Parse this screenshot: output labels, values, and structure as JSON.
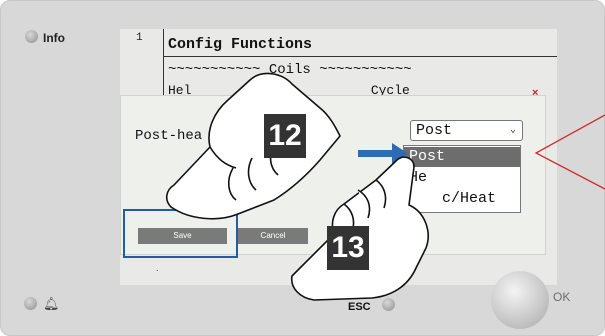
{
  "device": {
    "info_label": "Info",
    "esc_label": "ESC",
    "ok_label": "OK",
    "bell_icon": "bell-icon"
  },
  "screen": {
    "line_number": "1",
    "title": "Config Functions",
    "section": "~~~~~~~~~~~ Coils ~~~~~~~~~~~",
    "partial_row": "Hel                       Cycle",
    "dialog": {
      "label": "Post-hea",
      "close": "×",
      "select_value": "Post",
      "options": [
        "Post",
        "Heat",
        "Recirc/Heat"
      ],
      "options_shown": [
        "Post",
        "He",
        "c/Heat"
      ],
      "selected_option": "Post",
      "save_label": "Save",
      "cancel_label": "Cancel"
    }
  },
  "annotations": {
    "step_12": "12",
    "step_13": "13",
    "arrow_color": "#2f6bb3",
    "callout_color": "#d42a2a",
    "highlight_color": "#1f5da8"
  }
}
